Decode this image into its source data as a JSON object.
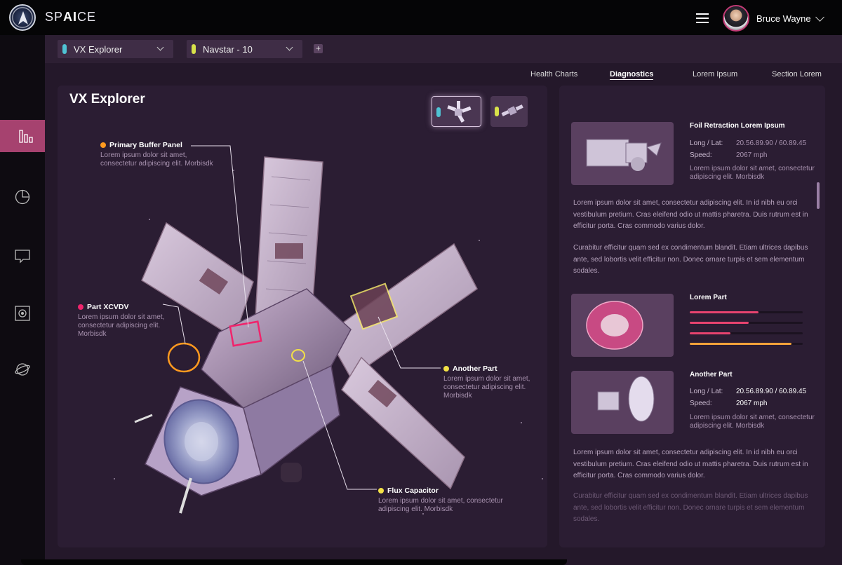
{
  "brand": {
    "prefix": "SP",
    "bold": "AI",
    "suffix": "CE"
  },
  "user": {
    "name": "Bruce Wayne"
  },
  "sidebar": {
    "items": [
      {
        "icon": "bar-chart-icon",
        "active": true
      },
      {
        "icon": "pie-chart-icon",
        "active": false
      },
      {
        "icon": "chat-icon",
        "active": false
      },
      {
        "icon": "target-icon",
        "active": false
      },
      {
        "icon": "planet-icon",
        "active": false
      }
    ]
  },
  "selectors": [
    {
      "label": "VX Explorer",
      "color": "#4fc3d4"
    },
    {
      "label": "Navstar - 10",
      "color": "#d8e24a"
    }
  ],
  "add_button": {
    "label": "+"
  },
  "tabs": [
    {
      "label": "Health Charts",
      "active": false
    },
    {
      "label": "Diagnostics",
      "active": true
    },
    {
      "label": "Lorem Ipsum",
      "active": false
    },
    {
      "label": "Section Lorem",
      "active": false
    }
  ],
  "diagram": {
    "title": "VX Explorer",
    "thumbs": [
      {
        "color": "#4fc3d4",
        "active": true
      },
      {
        "color": "#d8e24a",
        "active": false
      }
    ],
    "callouts": [
      {
        "title": "Primary Buffer Panel",
        "color": "#ff9a1f",
        "desc": "Lorem ipsum dolor sit amet, consectetur adipiscing elit. Morbisdk"
      },
      {
        "title": "Part XCVDV",
        "color": "#f0246c",
        "desc": "Lorem ipsum dolor sit amet, consectetur adipiscing elit. Morbisdk"
      },
      {
        "title": "Another Part",
        "color": "#f3e146",
        "desc": "Lorem ipsum dolor sit amet, consectetur adipiscing elit. Morbisdk"
      },
      {
        "title": "Flux Capacitor",
        "color": "#f3e146",
        "desc": "Lorem ipsum dolor sit amet, consectetur adipiscing elit. Morbisdk"
      }
    ]
  },
  "details": {
    "card1": {
      "title": "Foil Retraction Lorem Ipsum",
      "k1": "Long / Lat:",
      "v1": "20.56.89.90 / 60.89.45",
      "k2": "Speed:",
      "v2": "2067 mph",
      "note": "Lorem ipsum dolor sit amet, consectetur adipiscing elit. Morbisdk"
    },
    "para1": "Lorem ipsum dolor sit amet, consectetur adipiscing elit. In id nibh eu orci vestibulum pretium. Cras eleifend odio ut mattis pharetra. Duis rutrum est in efficitur porta. Cras commodo varius dolor.",
    "para2": "Curabitur efficitur quam sed ex condimentum blandit. Etiam ultrices dapibus ante, sed lobortis velit efficitur non. Donec ornare turpis et sem elementum sodales.",
    "card2": {
      "title": "Lorem Part",
      "bars": [
        0.61,
        0.52,
        0.36,
        0.9
      ],
      "bar_colors": [
        "#e8436f",
        "#e8436f",
        "#e8436f",
        "#f4a23a"
      ]
    },
    "card3": {
      "title": "Another Part",
      "k1": "Long / Lat:",
      "v1": "20.56.89.90 / 60.89.45",
      "k2": "Speed:",
      "v2": "2067 mph",
      "note": "Lorem ipsum dolor sit amet, consectetur adipiscing elit. Morbisdk"
    },
    "para3": "Lorem ipsum dolor sit amet, consectetur adipiscing elit. In id nibh eu orci vestibulum pretium. Cras eleifend odio ut mattis pharetra. Duis rutrum est in efficitur porta. Cras commodo varius dolor.",
    "para4": "Curabitur efficitur quam sed ex condimentum blandit. Etiam ultrices dapibus ante, sed lobortis velit efficitur non. Donec ornare turpis et sem elementum sodales."
  }
}
